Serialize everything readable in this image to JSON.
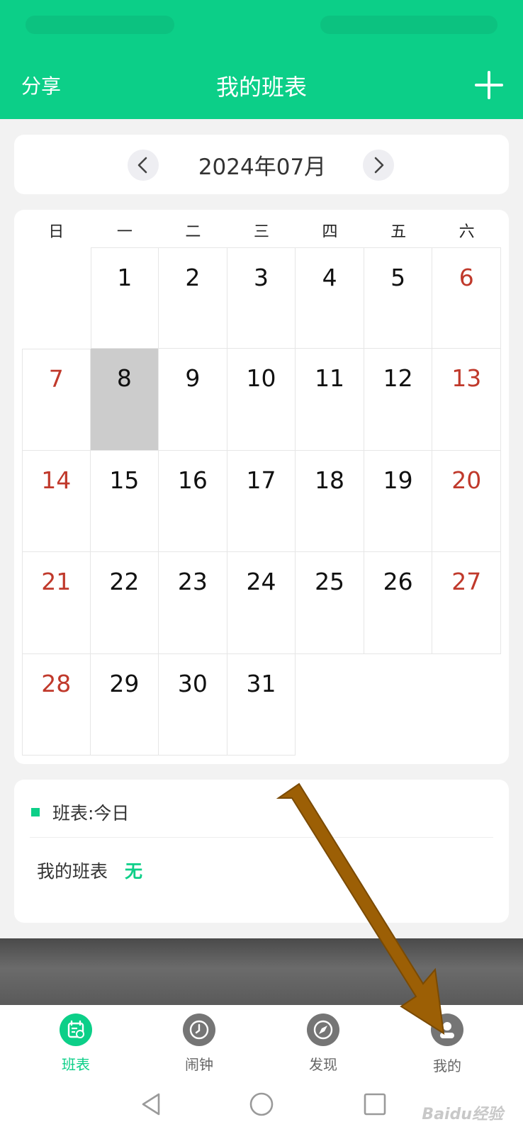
{
  "header": {
    "share_label": "分享",
    "title": "我的班表",
    "add_icon": "plus-icon"
  },
  "month_nav": {
    "label": "2024年07月",
    "prev_icon": "chevron-left-icon",
    "next_icon": "chevron-right-icon"
  },
  "calendar": {
    "weekdays": [
      "日",
      "一",
      "二",
      "三",
      "四",
      "五",
      "六"
    ],
    "today": "8",
    "weekend_color": "#c0392b",
    "weeks": [
      [
        "",
        "1",
        "2",
        "3",
        "4",
        "5",
        "6"
      ],
      [
        "7",
        "8",
        "9",
        "10",
        "11",
        "12",
        "13"
      ],
      [
        "14",
        "15",
        "16",
        "17",
        "18",
        "19",
        "20"
      ],
      [
        "21",
        "22",
        "23",
        "24",
        "25",
        "26",
        "27"
      ],
      [
        "28",
        "29",
        "30",
        "31",
        "",
        "",
        ""
      ]
    ]
  },
  "today_panel": {
    "title": "班表:今日",
    "row_label": "我的班表",
    "row_value": "无"
  },
  "tabbar": {
    "items": [
      {
        "label": "班表",
        "icon": "calendar-icon",
        "active": true
      },
      {
        "label": "闹钟",
        "icon": "clock-icon",
        "active": false
      },
      {
        "label": "发现",
        "icon": "compass-icon",
        "active": false
      },
      {
        "label": "我的",
        "icon": "person-icon",
        "active": false
      }
    ]
  },
  "colors": {
    "accent": "#0ccf88",
    "annotation_arrow": "#9c5f05"
  },
  "watermark": "Baidu经验"
}
